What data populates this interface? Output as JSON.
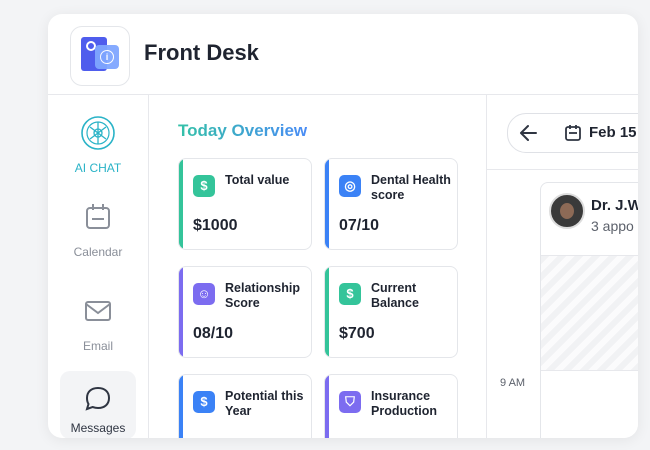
{
  "header": {
    "title": "Front Desk",
    "logo_icon": "front-desk-logo-icon"
  },
  "sidebar": {
    "items": [
      {
        "label": "AI CHAT",
        "icon": "ai-knot-icon"
      },
      {
        "label": "Calendar",
        "icon": "calendar-icon"
      },
      {
        "label": "Email",
        "icon": "mail-icon"
      },
      {
        "label": "Messages",
        "icon": "chat-bubble-icon"
      }
    ]
  },
  "overview": {
    "title": "Today Overview",
    "cards": [
      {
        "label": "Total value",
        "value": "$1000",
        "icon": "dollar-icon",
        "glyph": "$",
        "accent": "#34c49a"
      },
      {
        "label": "Dental Health score",
        "value": "07/10",
        "icon": "target-icon",
        "glyph": "◎",
        "accent": "#3b82f6"
      },
      {
        "label": "Relationship Score",
        "value": "08/10",
        "icon": "smile-icon",
        "glyph": "☺",
        "accent": "#7c6cf0"
      },
      {
        "label": "Current Balance",
        "value": "$700",
        "icon": "dollar-icon",
        "glyph": "$",
        "accent": "#34c49a"
      },
      {
        "label": "Potential this Year",
        "value": "",
        "icon": "dollar-icon",
        "glyph": "$",
        "accent": "#3b82f6"
      },
      {
        "label": "Insurance Production",
        "value": "",
        "icon": "shield-icon",
        "glyph": "⛉",
        "accent": "#7c6cf0"
      }
    ]
  },
  "calendar": {
    "date": "Feb 15",
    "doctor_name": "Dr. J.W",
    "doctor_sub": "3 appo",
    "time_label": "9 AM"
  },
  "colors": {
    "accent_teal": "#2ab3c7",
    "accent_blue": "#4a8cf6",
    "accent_green": "#33c1a7"
  }
}
